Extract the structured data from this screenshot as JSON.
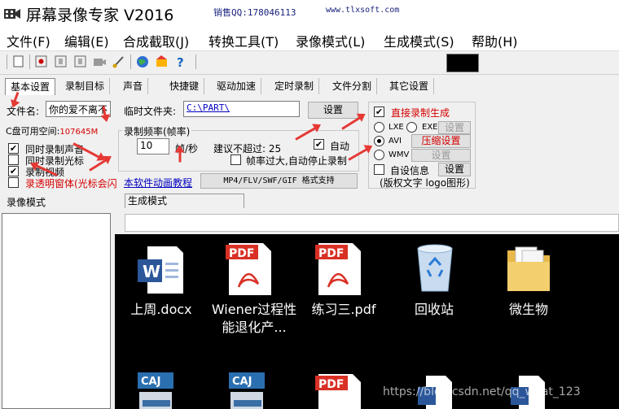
{
  "window": {
    "title": "屏幕录像专家 V2016"
  },
  "menu": [
    "文件(F)",
    "编辑(E)",
    "合成截取(J)",
    "转换工具(T)",
    "录像模式(L)",
    "生成模式(S)",
    "帮助(H)"
  ],
  "toolbar": {
    "qq": "销售QQ:178046113",
    "site": "www.tlxsoft.com"
  },
  "tabs": [
    "基本设置",
    "录制目标",
    "声音",
    "快捷键",
    "驱动加速",
    "定时录制",
    "文件分割",
    "其它设置"
  ],
  "form": {
    "filename_label": "文件名:",
    "filename_value": "你的爱不离不",
    "disk_label": "C盘可用空间:",
    "disk_value": "107645M",
    "tempdir_label": "临时文件夹:",
    "tempdir_value": "C:\\PART\\",
    "set_button": "设置",
    "rate_group": "录制频率(帧率)",
    "rate_value": "10",
    "rate_unit": "帧/秒",
    "limit_text": "建议不超过: 25",
    "auto_label": "自动",
    "autostop_label": "帧率过大,自动停止录制",
    "record_sound": "同时录制声音",
    "record_cursor": "同时录制光标",
    "record_video": "录制视频",
    "transparent": "录透明窗体(光标会闪",
    "tutorial_link": "本软件动画教程",
    "formats_button": "MP4/FLV/SWF/GIF  格式支持",
    "direct_generate": "直接录制生成",
    "lxe": "LXE",
    "exe": "EXE",
    "avi": "AVI",
    "wmv": "WMV",
    "lxe_set": "设置",
    "compress_set": "压缩设置",
    "wmv_set": "设置",
    "custom_info": "自设信息",
    "custom_set": "设置",
    "copyright": "(版权文字 logo图形)"
  },
  "panels": {
    "record_mode": "录像模式",
    "generate_mode": "生成模式"
  },
  "desktop_icons": [
    {
      "label": "上周.docx",
      "icon": "word-icon"
    },
    {
      "label": "Wiener过程性能退化产...",
      "icon": "pdf-icon"
    },
    {
      "label": "练习三.pdf",
      "icon": "pdf-icon"
    },
    {
      "label": "回收站",
      "icon": "recycle-bin-icon"
    },
    {
      "label": "微生物",
      "icon": "folder-icon"
    }
  ],
  "desktop_icons_row2": [
    "caj-icon",
    "caj-icon",
    "pdf-icon",
    "word-icon",
    "word-icon"
  ],
  "watermark": "https://blog.csdn.net/qq_what_123",
  "colors": {
    "accent_red": "#d50000",
    "annotation_arrow": "#e53935",
    "preview_bg": "#000000"
  }
}
